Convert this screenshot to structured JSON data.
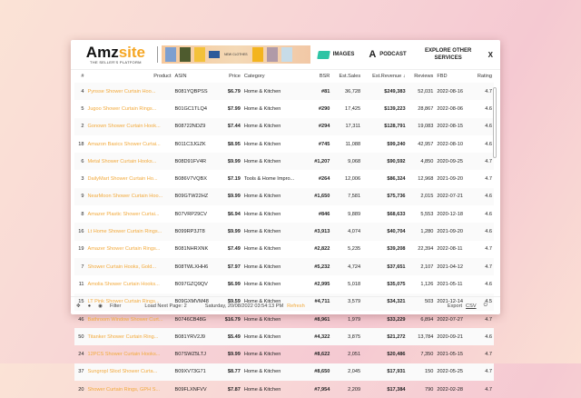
{
  "header": {
    "logo": "Amzsite",
    "logo_accent": "site",
    "logo_main": "Amz",
    "tagline": "THE SELLER'S PLATFORM",
    "banner_text": "NEW CLOTHES",
    "images_label": "IMAGES",
    "podcast_label": "PODCAST",
    "explore_label": "EXPLORE OTHER SERVICES",
    "close_label": "X"
  },
  "table": {
    "columns": [
      "#",
      "Product",
      "ASIN",
      "Price",
      "Category",
      "BSR",
      "Est.Sales",
      "Est.Revenue ↓",
      "Reviews",
      "FBD",
      "Rating"
    ],
    "rows": [
      [
        "4",
        "Pynsse Shower Curtain Hoo...",
        "B081YQBPSS",
        "$6.79",
        "Home & Kitchen",
        "#81",
        "36,728",
        "$249,383",
        "52,031",
        "2022-08-16",
        "4.7"
      ],
      [
        "5",
        "Jugoo Shower Curtain Rings...",
        "B01GC1TLQ4",
        "$7.99",
        "Home & Kitchen",
        "#290",
        "17,425",
        "$139,223",
        "28,867",
        "2022-08-06",
        "4.6"
      ],
      [
        "2",
        "Gonown Shower Curtain Hook...",
        "B08722NDZ9",
        "$7.44",
        "Home & Kitchen",
        "#294",
        "17,311",
        "$128,791",
        "19,083",
        "2022-08-15",
        "4.6"
      ],
      [
        "18",
        "Amazon Basics Shower Curtai...",
        "B011C3JGZK",
        "$8.95",
        "Home & Kitchen",
        "#745",
        "11,088",
        "$99,240",
        "42,957",
        "2022-08-10",
        "4.6"
      ],
      [
        "6",
        "Metal Shower Curtain Hooks...",
        "B08D91FV4R",
        "$9.99",
        "Home & Kitchen",
        "#1,207",
        "9,068",
        "$90,592",
        "4,850",
        "2020-09-25",
        "4.7"
      ],
      [
        "3",
        "DailyMart Shower Curtain Ho...",
        "B086V7VQBX",
        "$7.19",
        "Tools & Home Impro...",
        "#264",
        "12,006",
        "$86,324",
        "12,968",
        "2021-09-20",
        "4.7"
      ],
      [
        "9",
        "NearMoon Shower Curtain Hoo...",
        "B09GTW22HZ",
        "$9.99",
        "Home & Kitchen",
        "#1,650",
        "7,581",
        "$75,736",
        "2,015",
        "2022-07-21",
        "4.6"
      ],
      [
        "8",
        "Amazer Plastic Shower Curtai...",
        "B07VRP29CV",
        "$6.94",
        "Home & Kitchen",
        "#846",
        "9,889",
        "$68,633",
        "5,553",
        "2020-12-18",
        "4.6"
      ],
      [
        "16",
        "Lt Home Shower Curtain Rings...",
        "B099RP3JT8",
        "$9.99",
        "Home & Kitchen",
        "#3,913",
        "4,074",
        "$40,704",
        "1,280",
        "2021-09-20",
        "4.6"
      ],
      [
        "19",
        "Amazer Shower Curtain Rings...",
        "B081NHRXNK",
        "$7.49",
        "Home & Kitchen",
        "#2,822",
        "5,235",
        "$39,208",
        "22,394",
        "2022-08-11",
        "4.7"
      ],
      [
        "7",
        "Shower Curtain Hooks, Gold...",
        "B08TWLXHH6",
        "$7.97",
        "Home & Kitchen",
        "#5,232",
        "4,724",
        "$37,651",
        "2,107",
        "2021-04-12",
        "4.7"
      ],
      [
        "11",
        "Amolia Shower Curtain Hooks...",
        "B097GZQ9QV",
        "$6.99",
        "Home & Kitchen",
        "#2,995",
        "5,018",
        "$35,075",
        "1,126",
        "2021-05-11",
        "4.6"
      ],
      [
        "15",
        "LT Pink Shower Curtain Rings...",
        "B09GXMVM48",
        "$9.59",
        "Home & Kitchen",
        "#4,711",
        "3,579",
        "$34,321",
        "503",
        "2021-12-14",
        "4.5"
      ],
      [
        "46",
        "Bathroom Window Shower Curt...",
        "B0746CB48G",
        "$16.79",
        "Home & Kitchen",
        "#8,961",
        "1,979",
        "$33,229",
        "6,894",
        "2022-07-27",
        "4.7"
      ],
      [
        "50",
        "Titanker Shower Curtain Ring...",
        "B081YRV2J9",
        "$5.49",
        "Home & Kitchen",
        "#4,322",
        "3,875",
        "$21,272",
        "13,784",
        "2020-09-21",
        "4.6"
      ],
      [
        "24",
        "12PCS Shower Curtain Hooks...",
        "B07SWZ5LTJ",
        "$9.99",
        "Home & Kitchen",
        "#8,622",
        "2,051",
        "$20,486",
        "7,350",
        "2021-05-15",
        "4.7"
      ],
      [
        "37",
        "Sungropl Sliod Shower Curta...",
        "B09XV73G71",
        "$8.77",
        "Home & Kitchen",
        "#8,650",
        "2,045",
        "$17,931",
        "150",
        "2022-05-25",
        "4.7"
      ],
      [
        "20",
        "Shower Curtain Rings, GPH S...",
        "B09FLXNFVV",
        "$7.87",
        "Home & Kitchen",
        "#7,954",
        "2,209",
        "$17,384",
        "790",
        "2022-02-28",
        "4.7"
      ]
    ]
  },
  "footer": {
    "filter": "Filter",
    "load_next": "Load Next Page: 2",
    "timestamp": "Saturday, 20/08/2022 03:54:13 PM",
    "refresh": "Refresh",
    "export": "Export",
    "csv": "CSV"
  }
}
